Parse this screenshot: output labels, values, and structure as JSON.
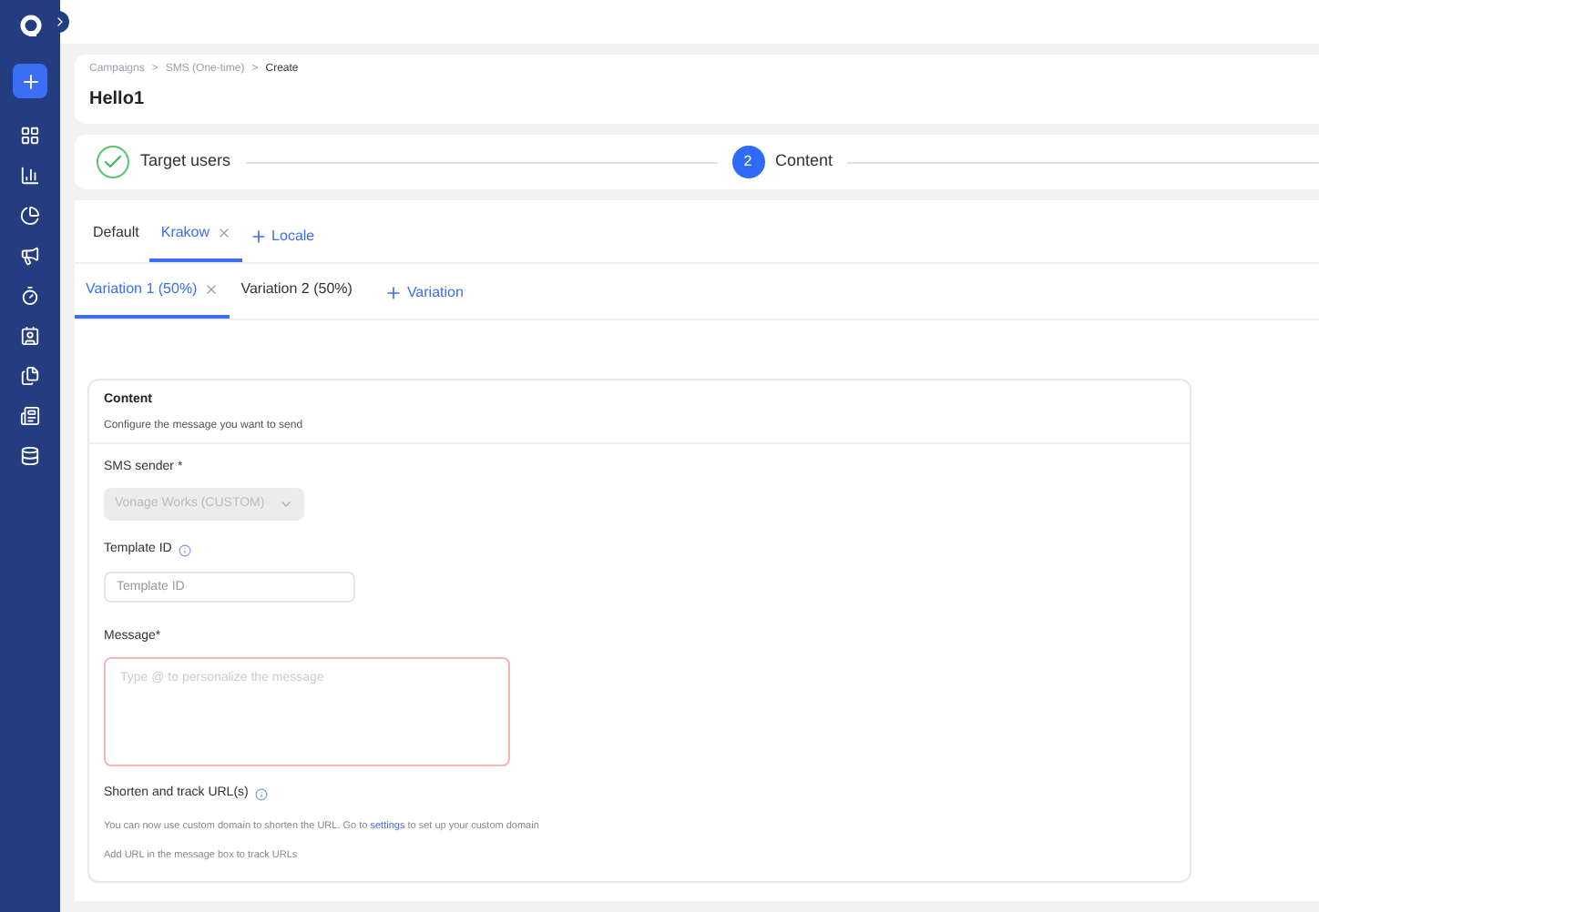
{
  "breadcrumb": [
    {
      "label": "Campaigns",
      "current": false
    },
    {
      "label": "SMS (One-time)",
      "current": false
    },
    {
      "label": "Create",
      "current": true
    }
  ],
  "breadcrumb_separator": ">",
  "title": "Hello1",
  "steps": [
    {
      "label": "Target users",
      "done": true
    },
    {
      "label": "Content",
      "done": false,
      "number": "2"
    }
  ],
  "locale_tabs": [
    {
      "label": "Default",
      "selected": false,
      "closable": false
    },
    {
      "label": "Krakow",
      "selected": true,
      "closable": true
    }
  ],
  "add_locale": "Locale",
  "variation_tabs": [
    {
      "label": "Variation 1 (50%)",
      "selected": true,
      "closable": true
    },
    {
      "label": "Variation 2 (50%)",
      "selected": false,
      "closable": false
    }
  ],
  "add_variation": "Variation",
  "content": {
    "title": "Content",
    "subtitle": "Configure the message you want to send",
    "sender_label": "SMS sender *",
    "sender_value": "Vonage Works (CUSTOM)",
    "sender_disabled": true,
    "template_label": "Template ID",
    "template_placeholder": "Template ID",
    "message_label": "Message*",
    "message_placeholder": "Type @ to personalize the message",
    "message_error": true,
    "shorten_label": "Shorten and track URL(s)",
    "shorten_text_before": "You can now use custom domain to shorten the URL. Go to",
    "shorten_link": "settings",
    "shorten_text_after": "to set up your custom domain",
    "shorten_hint": "Add URL in the message box to track URLs"
  }
}
